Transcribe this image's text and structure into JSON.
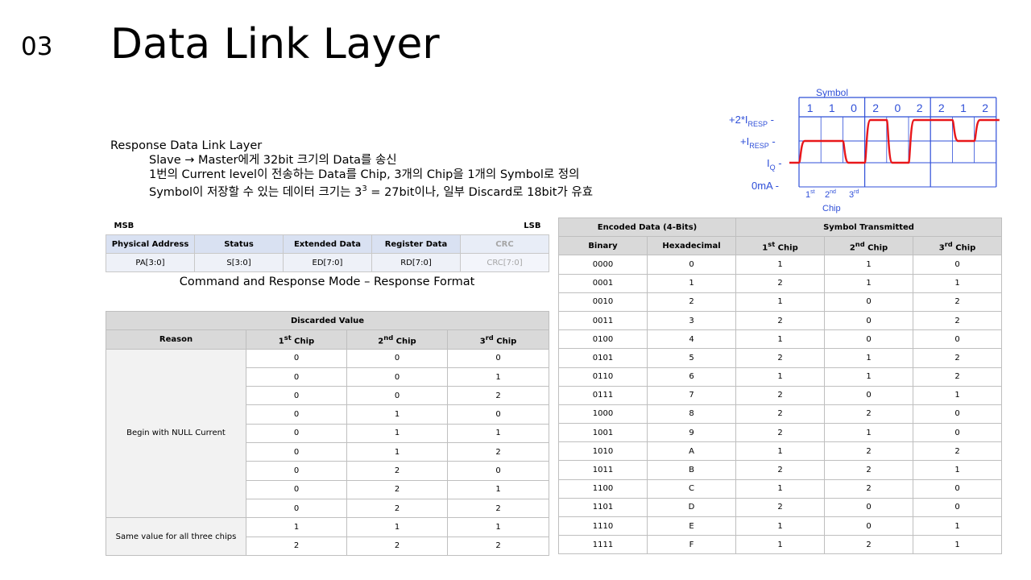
{
  "slide_number": "03",
  "title": "Data Link Layer",
  "description": {
    "heading": "Response Data Link Layer",
    "line1": "Slave → Master에게 32bit 크기의 Data를 송신",
    "line2": "1번의 Current level이 전송하는 Data를 Chip, 3개의 Chip을 1개의 Symbol로 정의",
    "line3_before": "Symbol이 저장할 수 있는 데이터 크기는 3",
    "line3_sup": "3",
    "line3_after": " = 27bit이나, 일부 Discard로 18bit가 유효"
  },
  "response_format": {
    "msb": "MSB",
    "lsb": "LSB",
    "fields": [
      "Physical Address",
      "Status",
      "Extended Data",
      "Register Data",
      "CRC"
    ],
    "values": [
      "PA[3:0]",
      "S[3:0]",
      "ED[7:0]",
      "RD[7:0]",
      "CRC[7:0]"
    ],
    "caption": "Command and Response Mode – Response Format"
  },
  "discarded": {
    "title": "Discarded Value",
    "reason_header": "Reason",
    "chip1_base": "1",
    "chip1_sup": "st",
    "chip2_base": "2",
    "chip2_sup": "nd",
    "chip3_base": "3",
    "chip3_sup": "rd",
    "chip_word": " Chip",
    "reason1": "Begin with NULL Current",
    "reason2": "Same value for all three chips",
    "rows": [
      [
        "0",
        "0",
        "0"
      ],
      [
        "0",
        "0",
        "1"
      ],
      [
        "0",
        "0",
        "2"
      ],
      [
        "0",
        "1",
        "0"
      ],
      [
        "0",
        "1",
        "1"
      ],
      [
        "0",
        "1",
        "2"
      ],
      [
        "0",
        "2",
        "0"
      ],
      [
        "0",
        "2",
        "1"
      ],
      [
        "0",
        "2",
        "2"
      ],
      [
        "1",
        "1",
        "1"
      ],
      [
        "2",
        "2",
        "2"
      ]
    ]
  },
  "encoding": {
    "group1": "Encoded Data (4-Bits)",
    "group2": "Symbol Transmitted",
    "col_binary": "Binary",
    "col_hex": "Hexadecimal",
    "rows": [
      [
        "0000",
        "0",
        "1",
        "1",
        "0"
      ],
      [
        "0001",
        "1",
        "2",
        "1",
        "1"
      ],
      [
        "0010",
        "2",
        "1",
        "0",
        "2"
      ],
      [
        "0011",
        "3",
        "2",
        "0",
        "2"
      ],
      [
        "0100",
        "4",
        "1",
        "0",
        "0"
      ],
      [
        "0101",
        "5",
        "2",
        "1",
        "2"
      ],
      [
        "0110",
        "6",
        "1",
        "1",
        "2"
      ],
      [
        "0111",
        "7",
        "2",
        "0",
        "1"
      ],
      [
        "1000",
        "8",
        "2",
        "2",
        "0"
      ],
      [
        "1001",
        "9",
        "2",
        "1",
        "0"
      ],
      [
        "1010",
        "A",
        "1",
        "2",
        "2"
      ],
      [
        "1011",
        "B",
        "2",
        "2",
        "1"
      ],
      [
        "1100",
        "C",
        "1",
        "2",
        "0"
      ],
      [
        "1101",
        "D",
        "2",
        "0",
        "0"
      ],
      [
        "1110",
        "E",
        "1",
        "0",
        "1"
      ],
      [
        "1111",
        "F",
        "1",
        "2",
        "1"
      ]
    ]
  },
  "diagram": {
    "symbol_label": "Symbol",
    "symbol_values": [
      "1",
      "1",
      "0",
      "2",
      "0",
      "2",
      "2",
      "1",
      "2"
    ],
    "level_2i": "+2*I",
    "level_2i_sub": "RESP",
    "level_i": "+I",
    "level_i_sub": "RESP",
    "level_iq": "I",
    "level_iq_sub": "Q",
    "level_0": "0mA",
    "chip_1": "1",
    "chip_1_sup": "st",
    "chip_2": "2",
    "chip_2_sup": "nd",
    "chip_3": "3",
    "chip_3_sup": "rd",
    "chip_label": "Chip",
    "blue": "#2f4fd8",
    "red": "#e8171b"
  }
}
